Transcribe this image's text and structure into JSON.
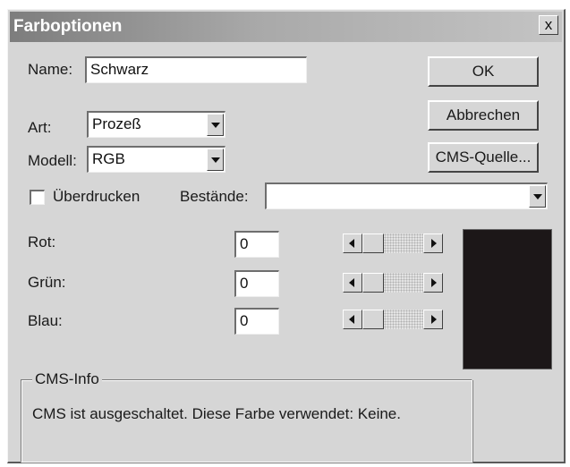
{
  "window": {
    "title": "Farboptionen",
    "close_label": "x"
  },
  "form": {
    "name_label": "Name:",
    "name_value": "Schwarz",
    "art_label": "Art:",
    "art_value": "Prozeß",
    "modell_label": "Modell:",
    "modell_value": "RGB",
    "overprint_label": "Überdrucken",
    "overprint_checked": false,
    "bestande_label": "Bestände:",
    "bestande_value": ""
  },
  "buttons": {
    "ok": "OK",
    "cancel": "Abbrechen",
    "cms_source": "CMS-Quelle..."
  },
  "channels": [
    {
      "label": "Rot:",
      "value": "0"
    },
    {
      "label": "Grün:",
      "value": "0"
    },
    {
      "label": "Blau:",
      "value": "0"
    }
  ],
  "preview": {
    "color": "#1c1718"
  },
  "cms_info": {
    "legend": "CMS-Info",
    "text": "CMS ist ausgeschaltet. Diese Farbe verwendet: Keine."
  }
}
